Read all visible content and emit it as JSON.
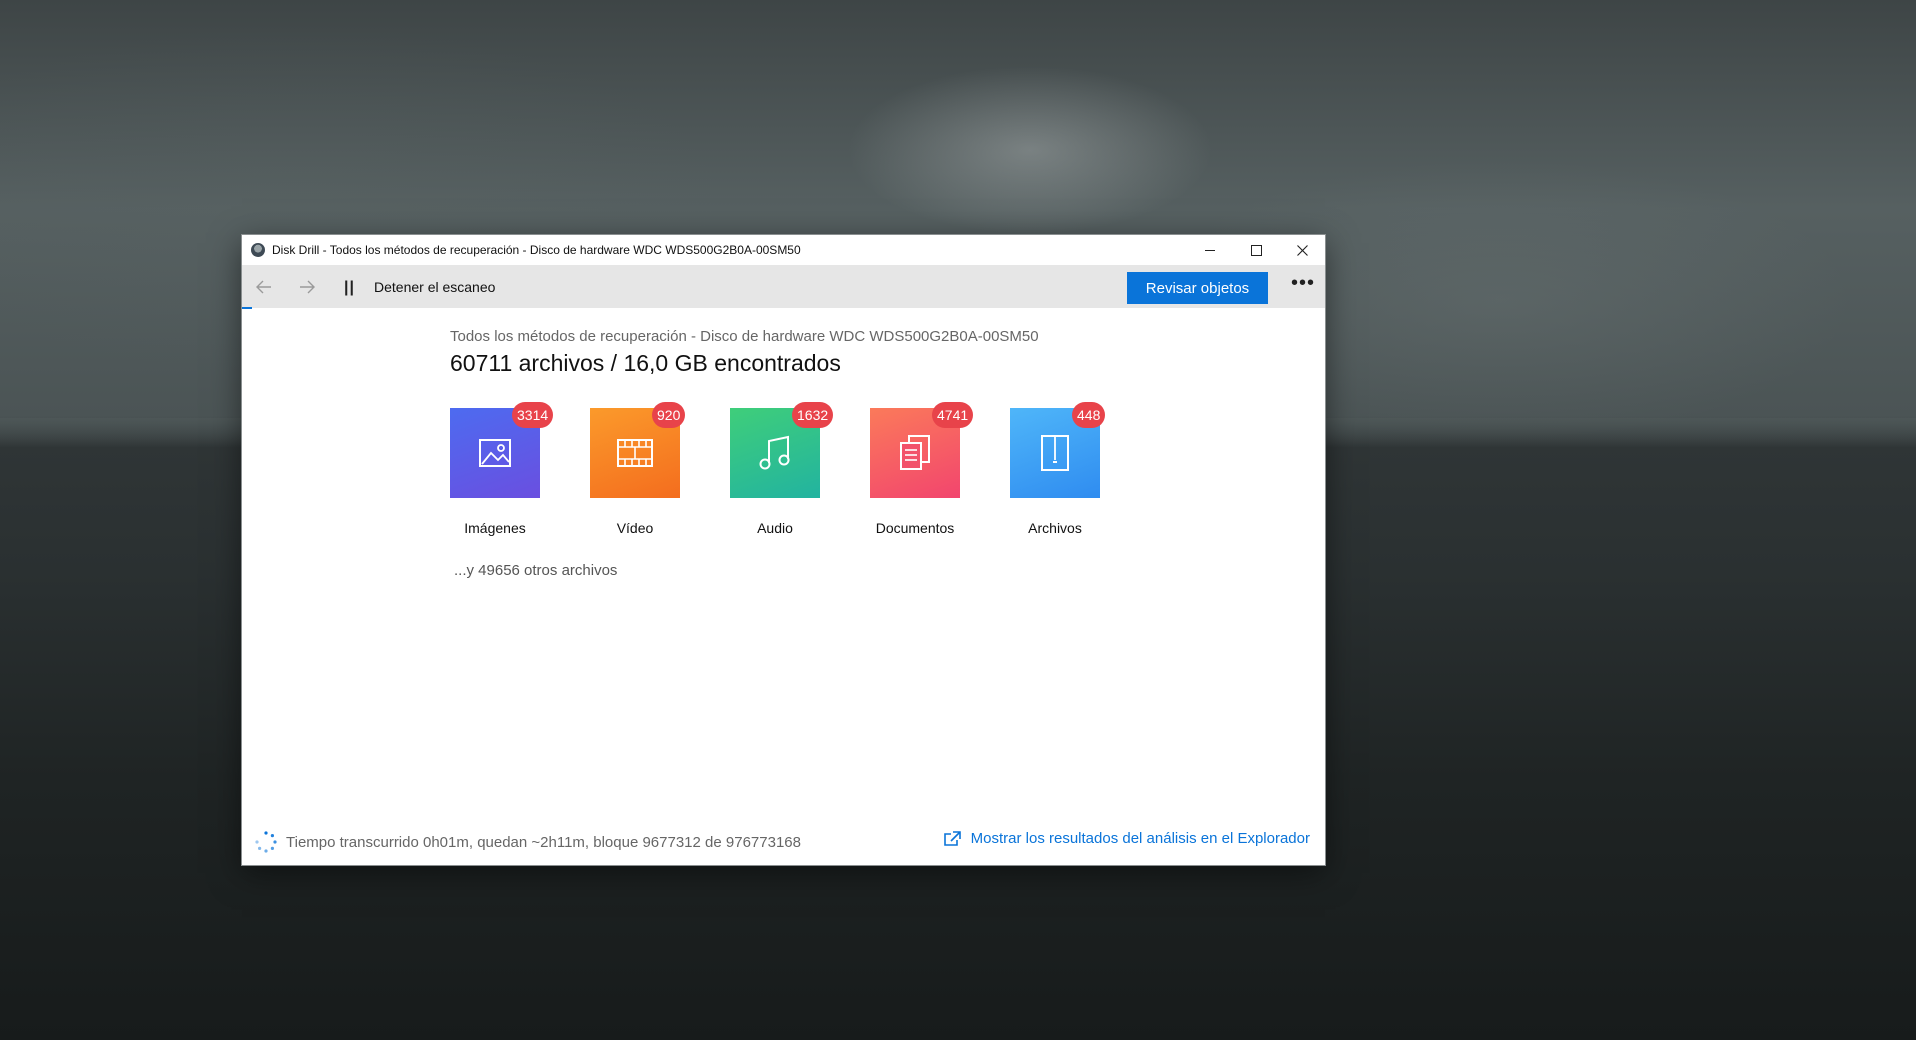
{
  "window": {
    "title": "Disk Drill - Todos los métodos de recuperación - Disco de hardware WDC WDS500G2B0A-00SM50"
  },
  "toolbar": {
    "back_icon": "arrow-left-icon",
    "forward_icon": "arrow-right-icon",
    "pause_symbol": "||",
    "stop_label": "Detener el escaneo",
    "review_label": "Revisar objetos",
    "more_symbol": "•••"
  },
  "main": {
    "subtitle": "Todos los métodos de recuperación - Disco de hardware WDC WDS500G2B0A-00SM50",
    "headline": "60711 archivos / 16,0 GB encontrados",
    "categories": [
      {
        "label": "Imágenes",
        "count": "3314",
        "icon": "image-icon",
        "color_top": "#4d6bf0",
        "color_bottom": "#6a4fe0"
      },
      {
        "label": "Vídeo",
        "count": "920",
        "icon": "film-icon",
        "color_top": "#fb9a2b",
        "color_bottom": "#f46d1e"
      },
      {
        "label": "Audio",
        "count": "1632",
        "icon": "music-note-icon",
        "color_top": "#3fce7a",
        "color_bottom": "#22b3a0"
      },
      {
        "label": "Documentos",
        "count": "4741",
        "icon": "documents-icon",
        "color_top": "#fb7a5a",
        "color_bottom": "#f2456e"
      },
      {
        "label": "Archivos",
        "count": "448",
        "icon": "archive-icon",
        "color_top": "#4fb6f9",
        "color_bottom": "#2f8cf0"
      }
    ],
    "others": "...y 49656 otros archivos"
  },
  "status": {
    "text": "Tiempo transcurrido 0h01m, quedan ~2h11m, bloque 9677312 de 976773168",
    "link": "Mostrar los resultados del análisis en el Explorador"
  },
  "colors": {
    "accent": "#0a74d9",
    "badge": "#e8434a"
  }
}
